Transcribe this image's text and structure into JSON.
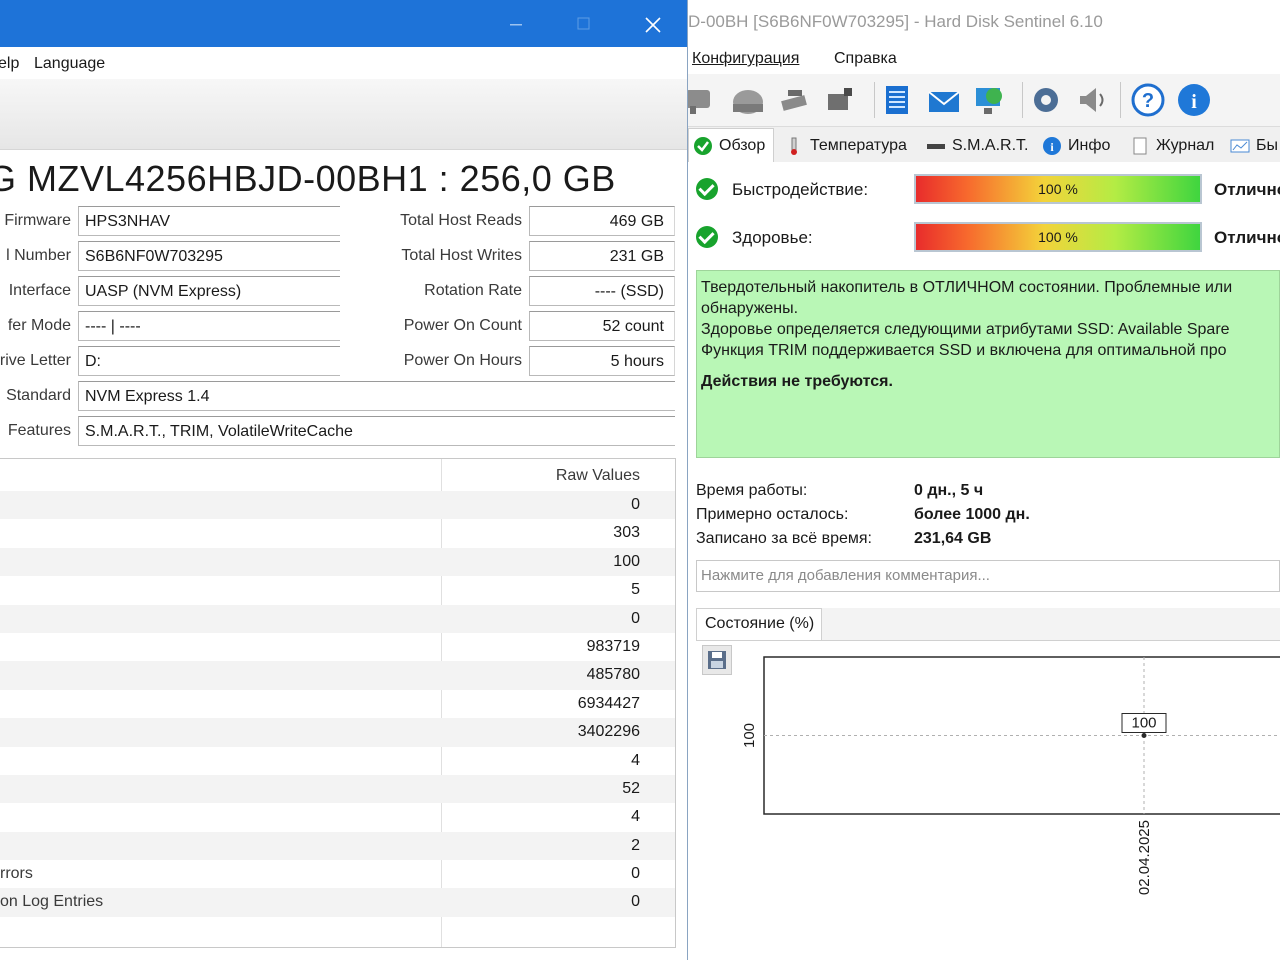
{
  "hds": {
    "title": "D-00BH [S6B6NF0W703295]  -  Hard Disk Sentinel 6.10",
    "menu": [
      "Конфигурация",
      "Справка"
    ],
    "tabs": [
      "Обзор",
      "Температура",
      "S.M.A.R.T.",
      "Инфо",
      "Журнал",
      "Бы"
    ],
    "performance": {
      "label": "Быстродействие:",
      "value": "100 %",
      "grade": "Отлично"
    },
    "health": {
      "label": "Здоровье:",
      "value": "100 %",
      "grade": "Отлично"
    },
    "summary": [
      "Твердотельный накопитель в ОТЛИЧНОМ состоянии. Проблемные или",
      "обнаружены.",
      "Здоровье определяется следующими атрибутами SSD: Available Spare",
      "Функция TRIM поддерживается SSD и включена для оптимальной про"
    ],
    "action": "Действия не требуются.",
    "info": [
      {
        "label": "Время работы:",
        "value": "0 дн., 5 ч"
      },
      {
        "label": "Примерно осталось:",
        "value": "более 1000 дн."
      },
      {
        "label": "Записано за всё время:",
        "value": "231,64 GB"
      }
    ],
    "comment_placeholder": "Нажмите для добавления комментария...",
    "chart_tab": "Состояние (%)"
  },
  "chart_data": {
    "type": "line",
    "x": [
      "02.04.2025"
    ],
    "series": [
      {
        "values": [
          100
        ]
      }
    ],
    "data_labels": [
      "100"
    ],
    "ytick": "100",
    "grid": true
  },
  "info_window": {
    "menu": [
      "elp",
      "Language"
    ],
    "drive_title": "G MZVL4256HBJD-00BH1 : 256,0 GB",
    "left_fields": [
      {
        "label": "Firmware",
        "value": "HPS3NHAV"
      },
      {
        "label": "l Number",
        "value": "S6B6NF0W703295"
      },
      {
        "label": "Interface",
        "value": "UASP (NVM Express)"
      },
      {
        "label": "fer Mode",
        "value": "---- | ----"
      },
      {
        "label": "rive Letter",
        "value": "D:"
      }
    ],
    "right_fields": [
      {
        "label": "Total Host Reads",
        "value": "469 GB"
      },
      {
        "label": "Total Host Writes",
        "value": "231 GB"
      },
      {
        "label": "Rotation Rate",
        "value": "---- (SSD)"
      },
      {
        "label": "Power On Count",
        "value": "52 count"
      },
      {
        "label": "Power On Hours",
        "value": "5 hours"
      }
    ],
    "wide_fields": [
      {
        "label": "Standard",
        "value": "NVM Express 1.4"
      },
      {
        "label": "Features",
        "value": "S.M.A.R.T., TRIM, VolatileWriteCache"
      }
    ],
    "raw_header": "Raw Values",
    "rows": [
      {
        "name": "",
        "value": "0"
      },
      {
        "name": "",
        "value": "303"
      },
      {
        "name": "",
        "value": "100"
      },
      {
        "name": "",
        "value": "5"
      },
      {
        "name": "",
        "value": "0"
      },
      {
        "name": "",
        "value": "983719"
      },
      {
        "name": "",
        "value": "485780"
      },
      {
        "name": "",
        "value": "6934427"
      },
      {
        "name": "",
        "value": "3402296"
      },
      {
        "name": "",
        "value": "4"
      },
      {
        "name": "",
        "value": "52"
      },
      {
        "name": "",
        "value": "4"
      },
      {
        "name": "",
        "value": "2"
      },
      {
        "name": "rrors",
        "value": "0"
      },
      {
        "name": "on Log Entries",
        "value": "0"
      }
    ]
  },
  "colors": {
    "titlebar_blue": "#1e73d8",
    "summary_green": "#b9f7b6",
    "check_green": "#18a32d"
  }
}
